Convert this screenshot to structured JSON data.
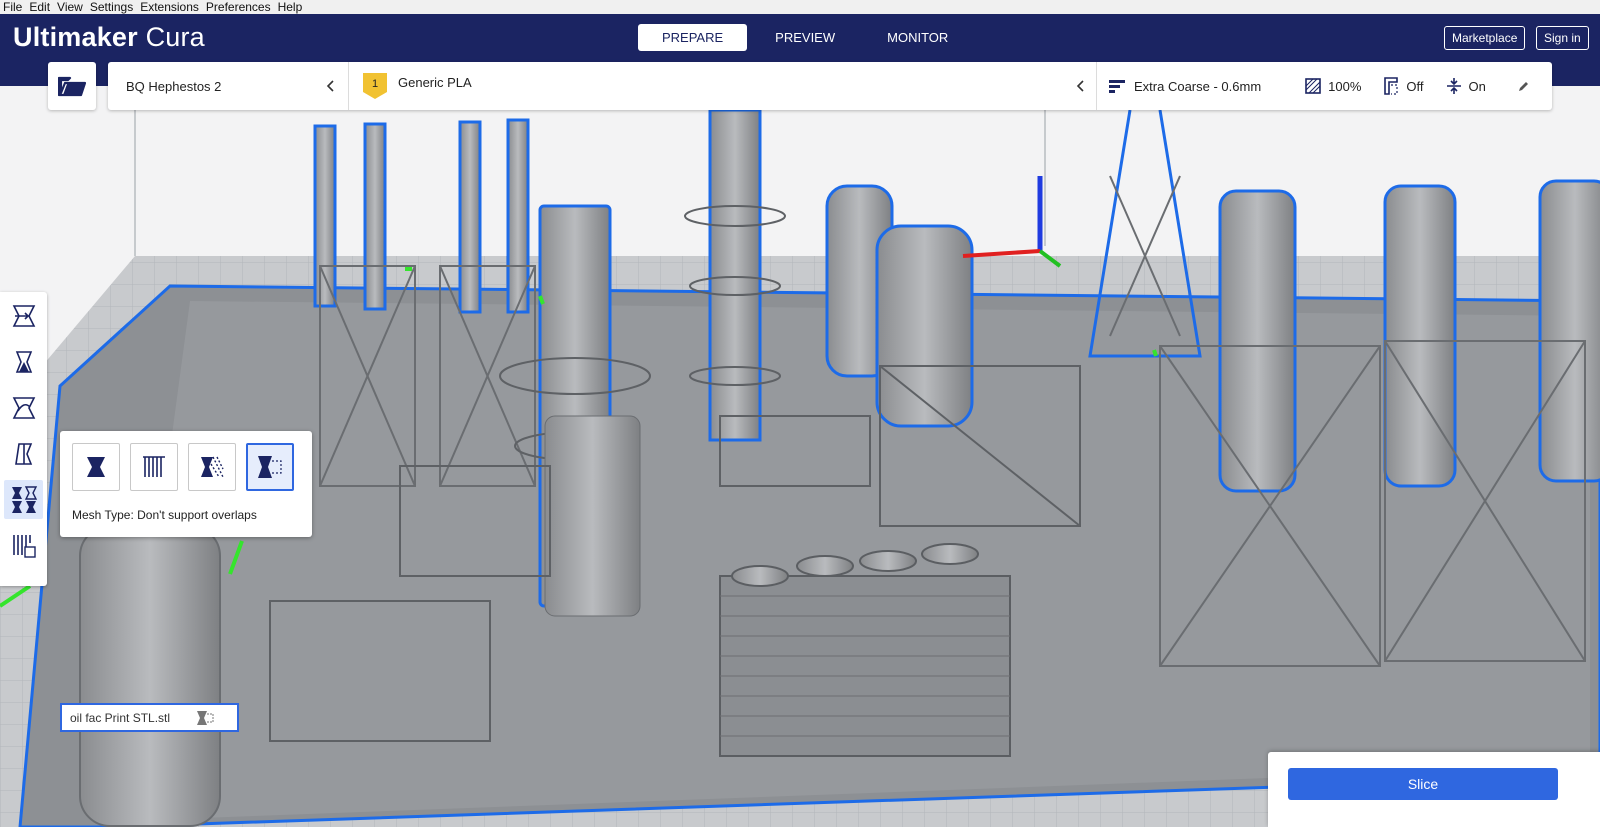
{
  "menu": [
    "File",
    "Edit",
    "View",
    "Settings",
    "Extensions",
    "Preferences",
    "Help"
  ],
  "app": {
    "brand_bold": "Ultimaker",
    "brand_light": "Cura"
  },
  "stages": [
    {
      "label": "PREPARE",
      "active": true
    },
    {
      "label": "PREVIEW",
      "active": false
    },
    {
      "label": "MONITOR",
      "active": false
    }
  ],
  "header_buttons": {
    "marketplace": "Marketplace",
    "signin": "Sign in"
  },
  "printer": {
    "name": "BQ Hephestos 2"
  },
  "material": {
    "extruder_number": "1",
    "name": "Generic PLA"
  },
  "print_settings": {
    "profile": "Extra Coarse - 0.6mm",
    "infill": "100%",
    "support": "Off",
    "adhesion": "On"
  },
  "toolbar": {
    "tools": [
      "move-tool-icon",
      "scale-tool-icon",
      "rotate-tool-icon",
      "mirror-tool-icon",
      "per-model-settings-icon",
      "support-blocker-icon"
    ],
    "active_tool_index": 4
  },
  "mesh_panel": {
    "types": [
      "normal-model-icon",
      "print-as-support-icon",
      "modify-settings-overlaps-icon",
      "dont-support-overlaps-icon"
    ],
    "selected_index": 3,
    "label": "Mesh Type: Don't support overlaps"
  },
  "object": {
    "name": "oil fac Print STL.stl"
  },
  "slice": {
    "label": "Slice"
  },
  "colors": {
    "header": "#1b2462",
    "accent": "#2f67e0",
    "outline": "#1d6be8",
    "selection_green": "#35e52d"
  }
}
